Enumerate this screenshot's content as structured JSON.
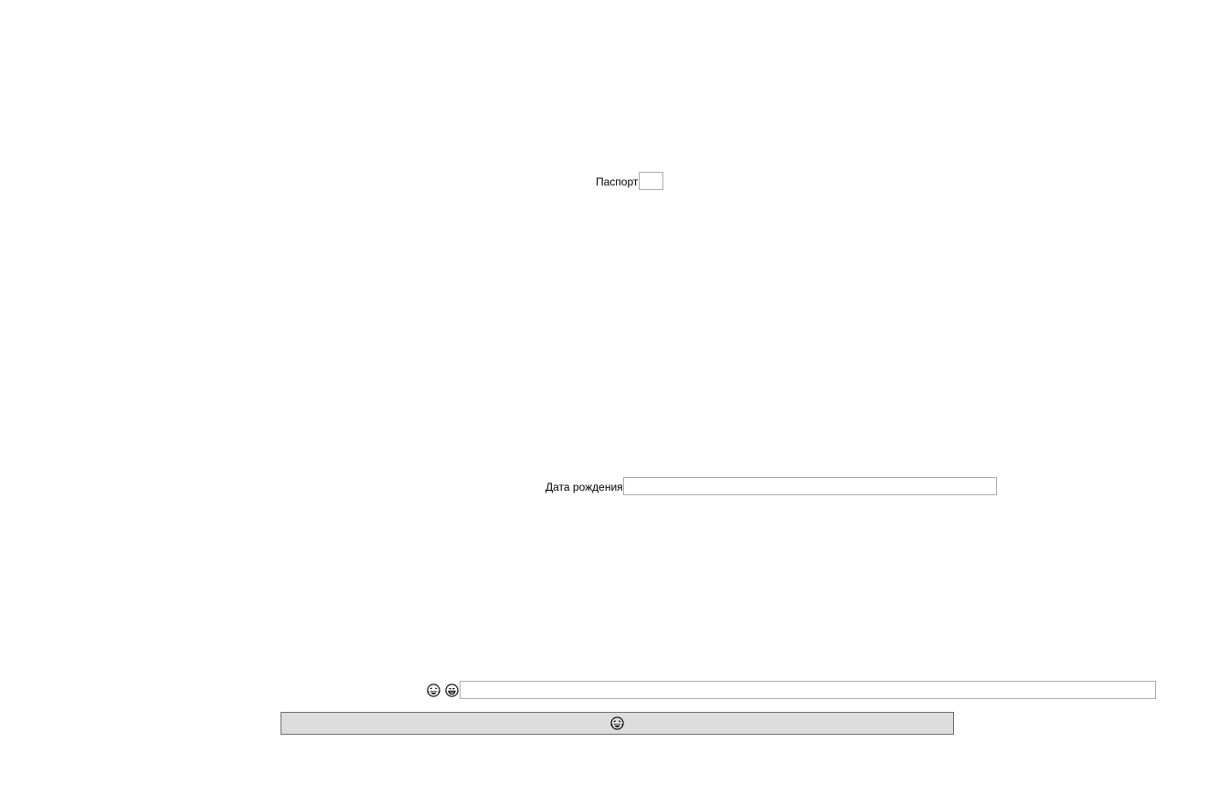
{
  "form": {
    "passport": {
      "label": "Паспорт",
      "value": ""
    },
    "birth_date": {
      "label": "Дата рождения",
      "value": ""
    },
    "emoji_row": {
      "icons": [
        "laughing-crying-face-icon",
        "grinning-face-icon"
      ],
      "value": ""
    },
    "submit_button": {
      "icon": "laughing-crying-face-icon"
    }
  },
  "colors": {
    "page_background": "#ffffff",
    "field_border": "#adadad",
    "button_background": "#dddddd",
    "button_border": "#707070"
  }
}
